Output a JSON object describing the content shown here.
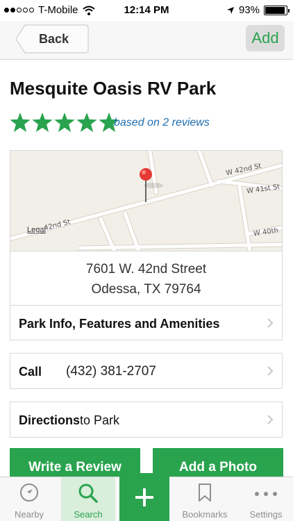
{
  "status_bar": {
    "carrier": "T-Mobile",
    "time": "12:14 PM",
    "battery": "93%",
    "battery_level": 0.93,
    "signal_bars_filled": 2,
    "signal_bars_total": 5
  },
  "nav": {
    "back_label": "Back",
    "add_label": "Add"
  },
  "park": {
    "name": "Mesquite Oasis RV Park",
    "rating": 5,
    "rating_max": 5,
    "reviews_text": "based on 2 reviews"
  },
  "map": {
    "streets": [
      "W 42nd St",
      "W 41st St",
      "42nd St",
      "W 40th"
    ],
    "legal": "Legal"
  },
  "address": {
    "line1": "7601 W. 42nd Street",
    "line2": "Odessa, TX 79764"
  },
  "rows": {
    "info_label": "Park Info, Features and Amenities",
    "call_label": "Call",
    "call_number": "(432) 381-2707",
    "directions_bold": "Directions",
    "directions_rest": "to Park"
  },
  "actions": {
    "write_review": "Write a Review",
    "add_photo": "Add a Photo"
  },
  "tabs": [
    {
      "label": "Nearby",
      "icon": "compass-icon"
    },
    {
      "label": "Search",
      "icon": "search-icon",
      "selected": true
    },
    {
      "label": "",
      "icon": "plus-icon"
    },
    {
      "label": "Bookmarks",
      "icon": "bookmark-icon"
    },
    {
      "label": "Settings",
      "icon": "more-icon"
    }
  ],
  "colors": {
    "accent_green": "#2aa34f",
    "link_blue": "#1f6fb2",
    "pin_red": "#e53935"
  }
}
